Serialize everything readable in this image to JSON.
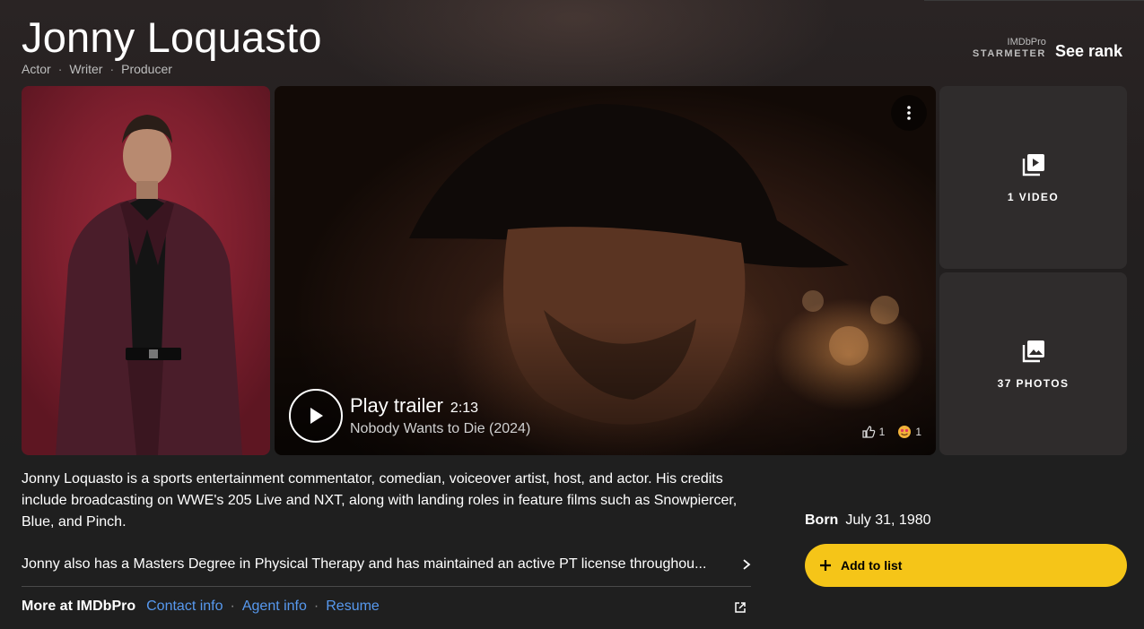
{
  "person": {
    "name": "Jonny Loquasto",
    "roles": [
      "Actor",
      "Writer",
      "Producer"
    ]
  },
  "starmeter": {
    "pro_label": "IMDbPro",
    "label": "STARMETER",
    "link": "See rank"
  },
  "trailer": {
    "title": "Play trailer",
    "duration": "2:13",
    "subtitle": "Nobody Wants to Die (2024)",
    "likes": "1",
    "reactions": "1"
  },
  "media": {
    "videos_label": "1 VIDEO",
    "photos_label": "37 PHOTOS"
  },
  "bio": {
    "summary": "Jonny Loquasto is a sports entertainment commentator, comedian, voiceover artist, host, and actor. His credits include broadcasting on WWE's 205 Live and NXT, along with landing roles in feature films such as Snowpiercer, Blue, and Pinch.",
    "more": "Jonny also has a Masters Degree in Physical Therapy and has maintained an active PT license throughou..."
  },
  "imdbpro": {
    "lead": "More at IMDbPro",
    "links": [
      "Contact info",
      "Agent info",
      "Resume"
    ]
  },
  "born": {
    "label": "Born",
    "date": "July 31, 1980"
  },
  "actions": {
    "add_to_list": "Add to list"
  },
  "colors": {
    "accent": "#f5c518",
    "link": "#5799ef",
    "background": "#1f1f1f"
  }
}
